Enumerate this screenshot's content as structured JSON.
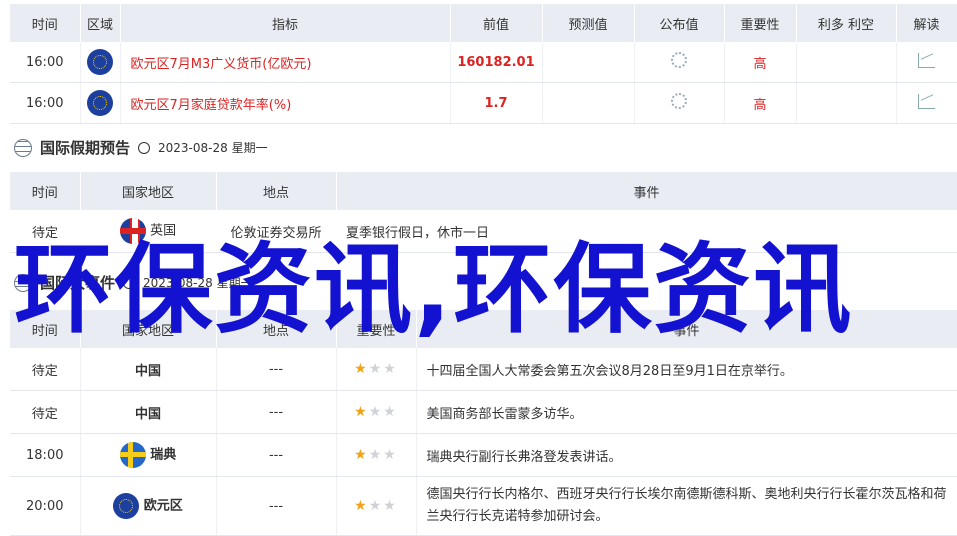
{
  "table1": {
    "headers": [
      "时间",
      "区域",
      "指标",
      "前值",
      "预测值",
      "公布值",
      "重要性",
      "利多 利空",
      "解读"
    ],
    "rows": [
      {
        "time": "16:00",
        "region_icon": "eu-flag-icon",
        "indicator": "欧元区7月M3广义货币(亿欧元)",
        "previous": "160182.01",
        "forecast": "",
        "actual": "",
        "importance": "高",
        "impact": ""
      },
      {
        "time": "16:00",
        "region_icon": "eu-flag-icon",
        "indicator": "欧元区7月家庭贷款年率(%)",
        "previous": "1.7",
        "forecast": "",
        "actual": "",
        "importance": "高",
        "impact": ""
      }
    ]
  },
  "holiday": {
    "title": "国际假期预告",
    "date": "2023-08-28 星期一",
    "headers": [
      "时间",
      "国家地区",
      "地点",
      "事件"
    ],
    "rows": [
      {
        "time": "待定",
        "country": "英国",
        "place": "伦敦证券交易所",
        "event": "夏季银行假日，休市一日"
      }
    ]
  },
  "events": {
    "title": "国际大事件",
    "date": "2023-08-28 星期一",
    "headers": [
      "时间",
      "国家地区",
      "地点",
      "重要性",
      "事件"
    ],
    "rows": [
      {
        "time": "待定",
        "country": "中国",
        "place": "---",
        "stars": 1,
        "event": "十四届全国人大常委会第五次会议8月28日至9月1日在京举行。"
      },
      {
        "time": "待定",
        "country": "中国",
        "place": "---",
        "stars": 1,
        "event": "美国商务部长雷蒙多访华。"
      },
      {
        "time": "18:00",
        "country": "瑞典",
        "place": "---",
        "stars": 1,
        "event": "瑞典央行副行长弗洛登发表讲话。"
      },
      {
        "time": "20:00",
        "country": "欧元区",
        "place": "---",
        "stars": 1,
        "event": "德国央行行长内格尔、西班牙央行行长埃尔南德斯德科斯、奥地利央行行长霍尔茨瓦格和荷兰央行行长克诺特参加研讨会。"
      }
    ]
  },
  "watermark": "环保资讯,环保资讯",
  "colors": {
    "accent_red": "#dd2222",
    "watermark": "#1212d0",
    "header_bg": "#e9edf3"
  }
}
